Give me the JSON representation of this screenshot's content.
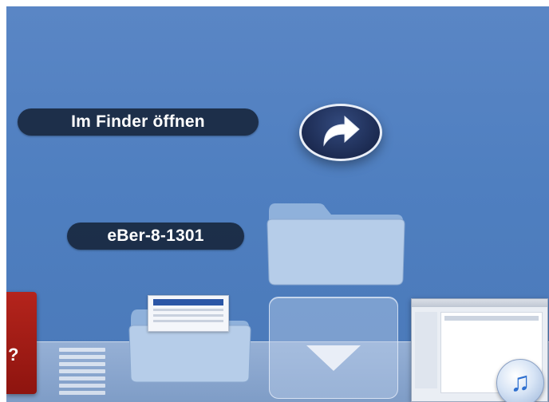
{
  "stack": {
    "open_in_finder_label": "Im Finder öffnen",
    "folder_label": "eBer-8-1301"
  },
  "icons": {
    "open_button": "curved-arrow-icon",
    "stack_folder": "folder-icon",
    "dock_folder": "folder-icon",
    "show_more": "chevron-down-icon",
    "dock_left_app": "red-app-icon",
    "dock_striped_app": "stripes-icon",
    "dock_window_thumbnail": "window-thumbnail",
    "music_badge": "music-note-icon"
  },
  "colors": {
    "desktop_blue": "#4f7fc0",
    "label_bg": "#0e1828",
    "folder_blue": "#a9c3e2",
    "red_app": "#b4241c"
  }
}
